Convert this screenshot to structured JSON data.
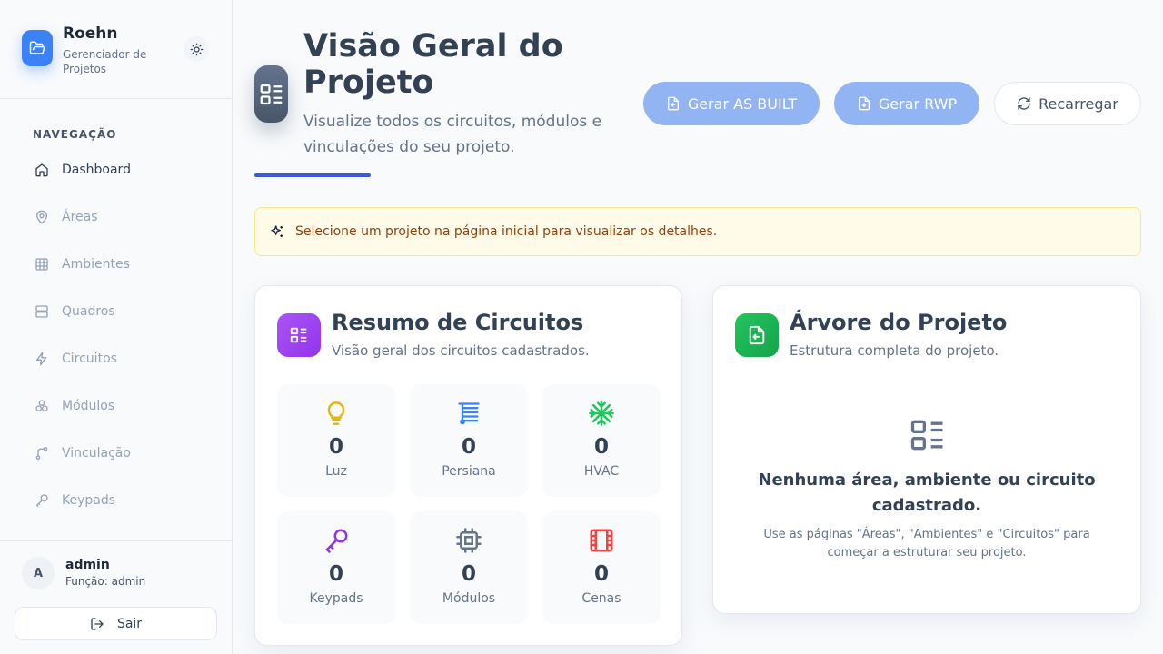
{
  "brand": {
    "name": "Roehn",
    "subtitle": "Gerenciador de Projetos"
  },
  "sidebar": {
    "heading": "NAVEGAÇÃO",
    "items": [
      {
        "label": "Dashboard",
        "icon": "home-icon"
      },
      {
        "label": "Áreas",
        "icon": "map-pin-icon"
      },
      {
        "label": "Ambientes",
        "icon": "grid-icon"
      },
      {
        "label": "Quadros",
        "icon": "server-icon"
      },
      {
        "label": "Circuitos",
        "icon": "lightning-icon"
      },
      {
        "label": "Módulos",
        "icon": "boxes-icon"
      },
      {
        "label": "Vinculação",
        "icon": "link-branch-icon"
      },
      {
        "label": "Keypads",
        "icon": "key-icon"
      }
    ]
  },
  "user": {
    "initial": "A",
    "name": "admin",
    "role": "Função: admin",
    "logout_label": "Sair"
  },
  "header": {
    "title": "Visão Geral do Projeto",
    "subtitle": "Visualize todos os circuitos, módulos e vinculações do seu projeto.",
    "buttons": {
      "as_built": "Gerar AS BUILT",
      "rwp": "Gerar RWP",
      "reload": "Recarregar"
    }
  },
  "alert": {
    "text": "Selecione um projeto na página inicial para visualizar os detalhes."
  },
  "summary": {
    "title": "Resumo de Circuitos",
    "subtitle": "Visão geral dos circuitos cadastrados.",
    "stats": [
      {
        "label": "Luz",
        "value": "0",
        "icon": "lightbulb-icon",
        "color": "#eab308"
      },
      {
        "label": "Persiana",
        "value": "0",
        "icon": "blinds-icon",
        "color": "#3b82f6"
      },
      {
        "label": "HVAC",
        "value": "0",
        "icon": "snowflake-icon",
        "color": "#22c55e"
      },
      {
        "label": "Keypads",
        "value": "0",
        "icon": "key-icon",
        "color": "#9333ea"
      },
      {
        "label": "Módulos",
        "value": "0",
        "icon": "cpu-icon",
        "color": "#64748b"
      },
      {
        "label": "Cenas",
        "value": "0",
        "icon": "film-icon",
        "color": "#ef4444"
      }
    ]
  },
  "tree": {
    "title": "Árvore do Projeto",
    "subtitle": "Estrutura completa do projeto.",
    "empty_title": "Nenhuma área, ambiente ou circuito cadastrado.",
    "empty_desc": "Use as páginas \"Áreas\", \"Ambientes\" e \"Circuitos\" para começar a estruturar seu projeto."
  },
  "colors": {
    "accent": "#3b5bdb",
    "primary_button": "#93b4f2",
    "summary_icon": "#9333ea",
    "tree_icon": "#16a34a"
  }
}
